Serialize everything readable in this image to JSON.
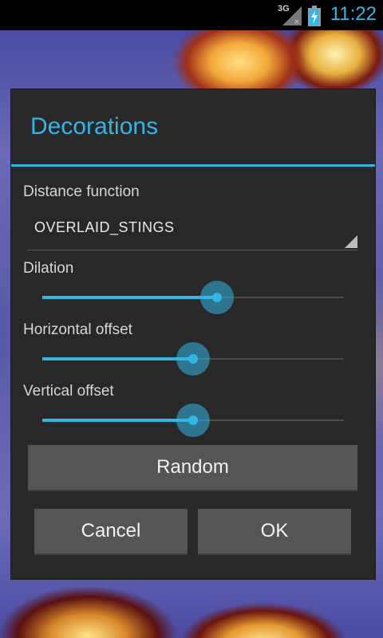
{
  "status_bar": {
    "network": "3G",
    "time": "11:22",
    "icons": [
      "signal-icon",
      "battery-charging-icon"
    ],
    "accent": "#33b5e5"
  },
  "dialog": {
    "title": "Decorations",
    "distance_function": {
      "label": "Distance function",
      "selected": "OVERLAID_STINGS"
    },
    "sliders": [
      {
        "label": "Dilation",
        "value": 0.58
      },
      {
        "label": "Horizontal offset",
        "value": 0.5
      },
      {
        "label": "Vertical offset",
        "value": 0.5
      }
    ],
    "random_button": "Random",
    "cancel_button": "Cancel",
    "ok_button": "OK"
  },
  "colors": {
    "accent": "#33b5e5",
    "dialog_bg": "#282828",
    "button_bg": "#555555"
  }
}
